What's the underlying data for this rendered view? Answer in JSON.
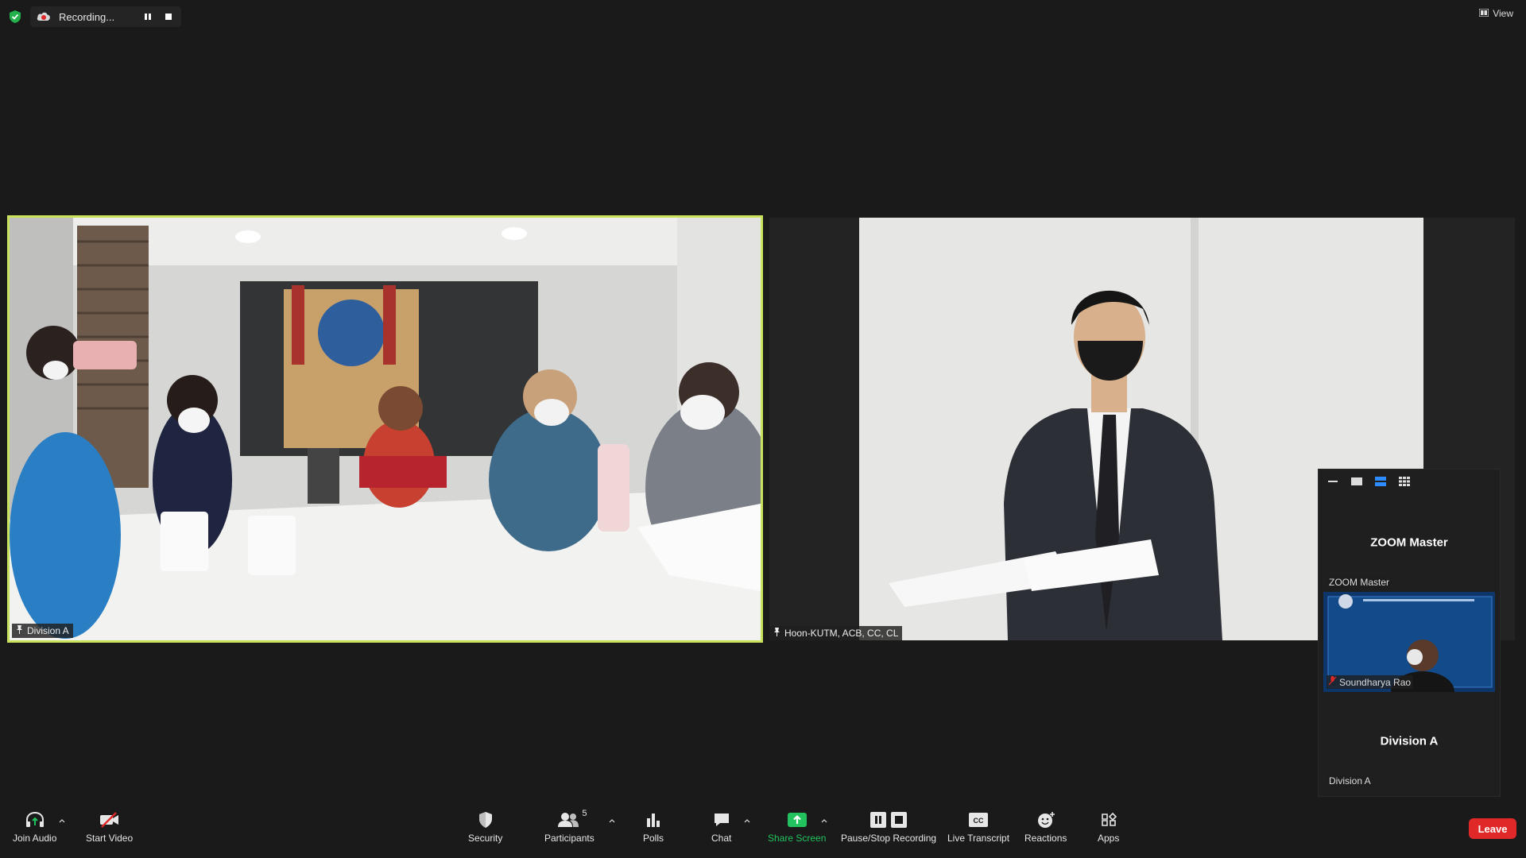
{
  "top_bar": {
    "recording_label": "Recording...",
    "view_label": "View"
  },
  "tiles": [
    {
      "name": "Division A"
    },
    {
      "name": "Hoon-KUTM, ACB, CC, CL"
    }
  ],
  "thumbnails": [
    {
      "center_name": "ZOOM Master",
      "label": "ZOOM Master"
    },
    {
      "label": "Soundharya Rao"
    },
    {
      "center_name": "Division A",
      "label": "Division A"
    }
  ],
  "toolbar": {
    "join_audio": "Join Audio",
    "start_video": "Start Video",
    "security": "Security",
    "participants": "Participants",
    "participants_count": "5",
    "polls": "Polls",
    "chat": "Chat",
    "share_screen": "Share Screen",
    "pause_stop_recording": "Pause/Stop Recording",
    "live_transcript": "Live Transcript",
    "reactions": "Reactions",
    "apps": "Apps",
    "leave": "Leave"
  },
  "colors": {
    "active_speaker_border": "#c8e35b",
    "share_screen_green": "#22c35e",
    "leave_red": "#e02828",
    "shield_green": "#23b14d"
  }
}
